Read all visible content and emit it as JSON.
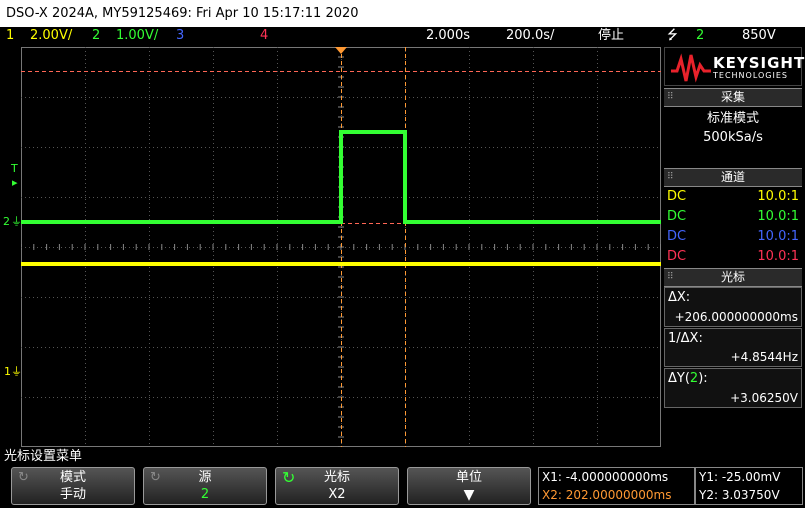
{
  "title": "DSO-X 2024A, MY59125469: Fri Apr 10 15:17:11 2020",
  "status": {
    "ch1_num": "1",
    "ch1_scale": "2.00V/",
    "ch2_num": "2",
    "ch2_scale": "1.00V/",
    "ch3_num": "3",
    "ch4_num": "4",
    "timebase": "2.000s",
    "delay": "200.0s/",
    "run_state": "停止",
    "trigger_icon": "trigger-edge-icon",
    "trigger_ch": "2",
    "trigger_level": "850V"
  },
  "markers": {
    "ch2": "2",
    "ch1": "1",
    "trig": "T"
  },
  "brand": {
    "name": "KEYSIGHT",
    "sub": "TECHNOLOGIES"
  },
  "acquire": {
    "title": "采集",
    "mode": "标准模式",
    "rate": "500kSa/s"
  },
  "channels": {
    "title": "通道",
    "rows": [
      {
        "coupling": "DC",
        "probe": "10.0:1",
        "color": "#ffff00"
      },
      {
        "coupling": "DC",
        "probe": "10.0:1",
        "color": "#33ff33"
      },
      {
        "coupling": "DC",
        "probe": "10.0:1",
        "color": "#4466ff"
      },
      {
        "coupling": "DC",
        "probe": "10.0:1",
        "color": "#ff3355"
      }
    ]
  },
  "cursors": {
    "title": "光标",
    "dx_label": "ΔX:",
    "dx_value": "+206.000000000ms",
    "inv_label": "1/ΔX:",
    "inv_value": "+4.8544Hz",
    "dy_label": "ΔY(",
    "dy_ch": "2",
    "dy_close": "):",
    "dy_value": "+3.06250V"
  },
  "menu": {
    "title": "光标设置菜单",
    "keys": [
      {
        "top": "模式",
        "bottom": "手动"
      },
      {
        "top": "源",
        "bottom": "2"
      },
      {
        "top": "光标",
        "bottom": "X2"
      },
      {
        "top": "单位",
        "bottom": ""
      }
    ]
  },
  "readouts": {
    "x1": "X1: -4.000000000ms",
    "x2": "X2: 202.00000000ms",
    "y1": "Y1: -25.00mV",
    "y2": "Y2: 3.03750V"
  },
  "colors": {
    "ch1": "#ffff00",
    "ch2": "#33ff33",
    "ch3": "#4466ff",
    "ch4": "#ff3355",
    "cursor_x": "#ff9933",
    "cursor_y": "#ff6655"
  }
}
